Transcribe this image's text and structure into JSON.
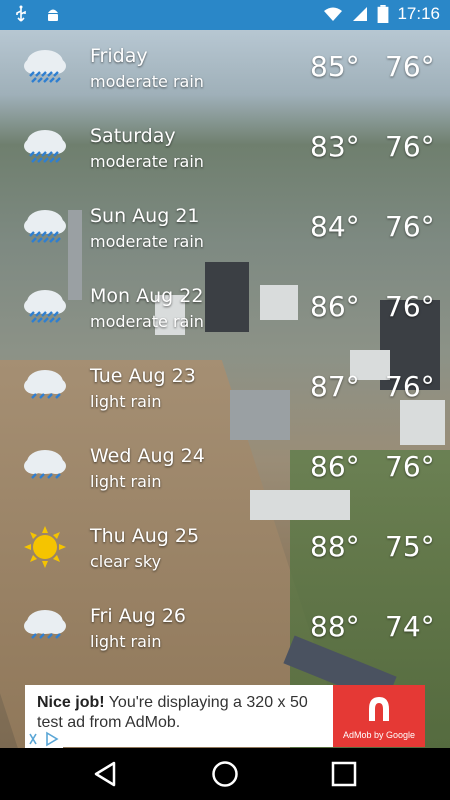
{
  "status_bar": {
    "time": "17:16",
    "left_icons": [
      "usb-icon",
      "android-icon"
    ],
    "right_icons": [
      "wifi-icon",
      "signal-icon",
      "battery-icon"
    ]
  },
  "forecast": [
    {
      "day": "Friday",
      "desc": "moderate rain",
      "high": "85°",
      "low": "76°",
      "icon": "rain-cloud-icon"
    },
    {
      "day": "Saturday",
      "desc": "moderate rain",
      "high": "83°",
      "low": "76°",
      "icon": "rain-cloud-icon"
    },
    {
      "day": "Sun Aug 21",
      "desc": "moderate rain",
      "high": "84°",
      "low": "76°",
      "icon": "rain-cloud-icon"
    },
    {
      "day": "Mon Aug 22",
      "desc": "moderate rain",
      "high": "86°",
      "low": "76°",
      "icon": "rain-cloud-icon"
    },
    {
      "day": "Tue Aug 23",
      "desc": "light rain",
      "high": "87°",
      "low": "76°",
      "icon": "rain-cloud-icon"
    },
    {
      "day": "Wed Aug 24",
      "desc": "light rain",
      "high": "86°",
      "low": "76°",
      "icon": "rain-cloud-icon"
    },
    {
      "day": "Thu Aug 25",
      "desc": "clear sky",
      "high": "88°",
      "low": "75°",
      "icon": "sun-icon"
    },
    {
      "day": "Fri Aug 26",
      "desc": "light rain",
      "high": "88°",
      "low": "74°",
      "icon": "rain-cloud-icon"
    }
  ],
  "ad": {
    "headline": "Nice job!",
    "body": "You're displaying a 320 x 50 test ad from AdMob.",
    "logo_text": "AdMob by Google"
  },
  "colors": {
    "status_bar": "#2a87c8",
    "ad_logo_bg": "#e53935",
    "sun": "#f5c400",
    "rain_drop": "#2f7fd1",
    "cloud": "#e9eef2"
  },
  "nav": {
    "icons": [
      "back-icon",
      "home-icon",
      "recents-icon"
    ]
  }
}
